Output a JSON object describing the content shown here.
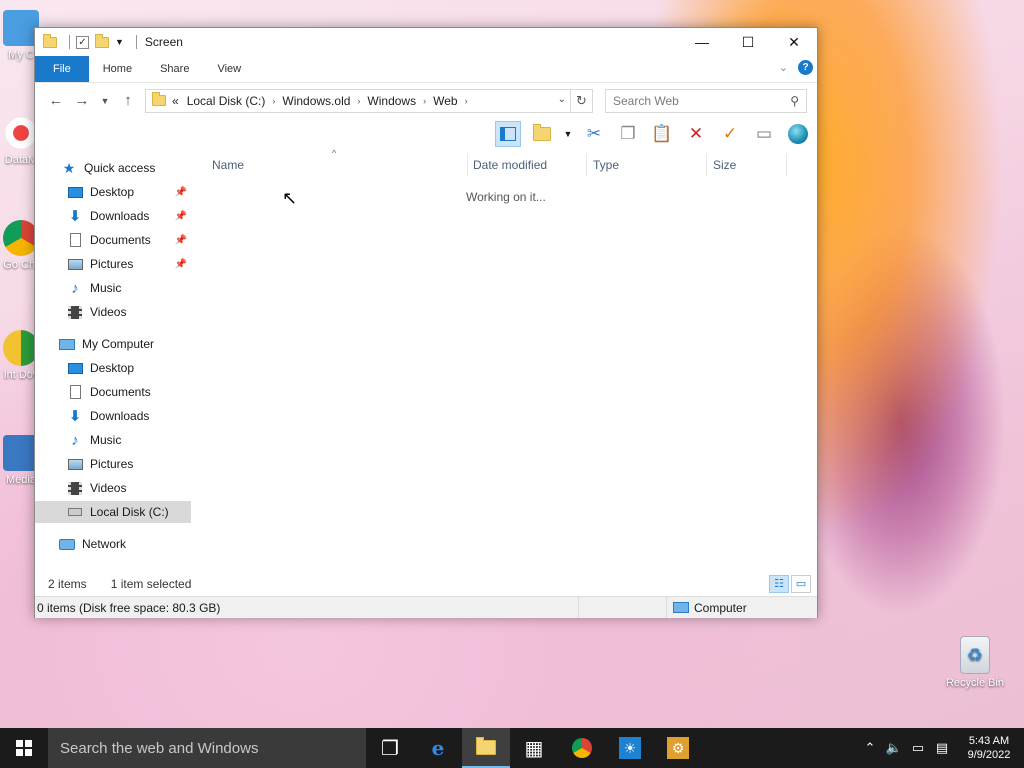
{
  "desktop": {
    "icons": [
      {
        "label": "My C"
      },
      {
        "label": "DataM"
      },
      {
        "label": "Go Chr"
      },
      {
        "label": "Int Dov"
      },
      {
        "label": "Media"
      },
      {
        "label": "Recycle Bin"
      }
    ]
  },
  "window": {
    "title": "Screen",
    "controls": {
      "minimize": "—",
      "maximize": "☐",
      "close": "✕"
    },
    "ribbon_tabs": [
      "File",
      "Home",
      "Share",
      "View"
    ],
    "address": {
      "overflow": "«",
      "crumbs": [
        "Local Disk (C:)",
        "Windows.old",
        "Windows",
        "Web"
      ]
    },
    "search": {
      "placeholder": "Search Web"
    },
    "columns": [
      "Name",
      "Date modified",
      "Type",
      "Size"
    ],
    "working_text": "Working on it...",
    "nav": {
      "quick_access": "Quick access",
      "quick_items": [
        "Desktop",
        "Downloads",
        "Documents",
        "Pictures",
        "Music",
        "Videos"
      ],
      "my_computer": "My Computer",
      "computer_items": [
        "Desktop",
        "Documents",
        "Downloads",
        "Music",
        "Pictures",
        "Videos",
        "Local Disk (C:)"
      ],
      "network": "Network"
    },
    "status_line": {
      "items": "2 items",
      "selected": "1 item selected"
    },
    "status_bar": {
      "left": "0 items (Disk free space: 80.3 GB)",
      "right": "Computer"
    }
  },
  "taskbar": {
    "search": "Search the web and Windows",
    "clock_time": "5:43 AM",
    "clock_date": "9/9/2022"
  }
}
